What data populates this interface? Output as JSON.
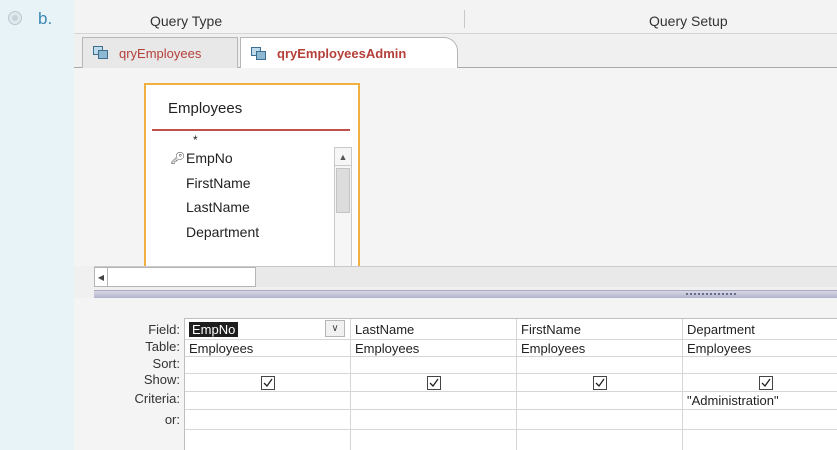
{
  "option": {
    "label": "b."
  },
  "ribbon": {
    "query_type": "Query Type",
    "query_setup": "Query Setup"
  },
  "tabs": [
    {
      "label": "qryEmployees",
      "active": false
    },
    {
      "label": "qryEmployeesAdmin",
      "active": true
    }
  ],
  "table": {
    "title": "Employees",
    "fields": [
      "*",
      "EmpNo",
      "FirstName",
      "LastName",
      "Department"
    ],
    "key_field": "EmpNo"
  },
  "grid": {
    "row_labels": [
      "Field:",
      "Table:",
      "Sort:",
      "Show:",
      "Criteria:",
      "or:"
    ],
    "columns": [
      {
        "field": "EmpNo",
        "table": "Employees",
        "sort": "",
        "show": true,
        "criteria": ""
      },
      {
        "field": "LastName",
        "table": "Employees",
        "sort": "",
        "show": true,
        "criteria": ""
      },
      {
        "field": "FirstName",
        "table": "Employees",
        "sort": "",
        "show": true,
        "criteria": ""
      },
      {
        "field": "Department",
        "table": "Employees",
        "sort": "",
        "show": true,
        "criteria": "\"Administration\""
      }
    ]
  },
  "colors": {
    "page_bg": "#e8f3f8",
    "tab_text": "#b5403a",
    "table_border": "#f0b040",
    "option_label": "#3a87b5"
  }
}
